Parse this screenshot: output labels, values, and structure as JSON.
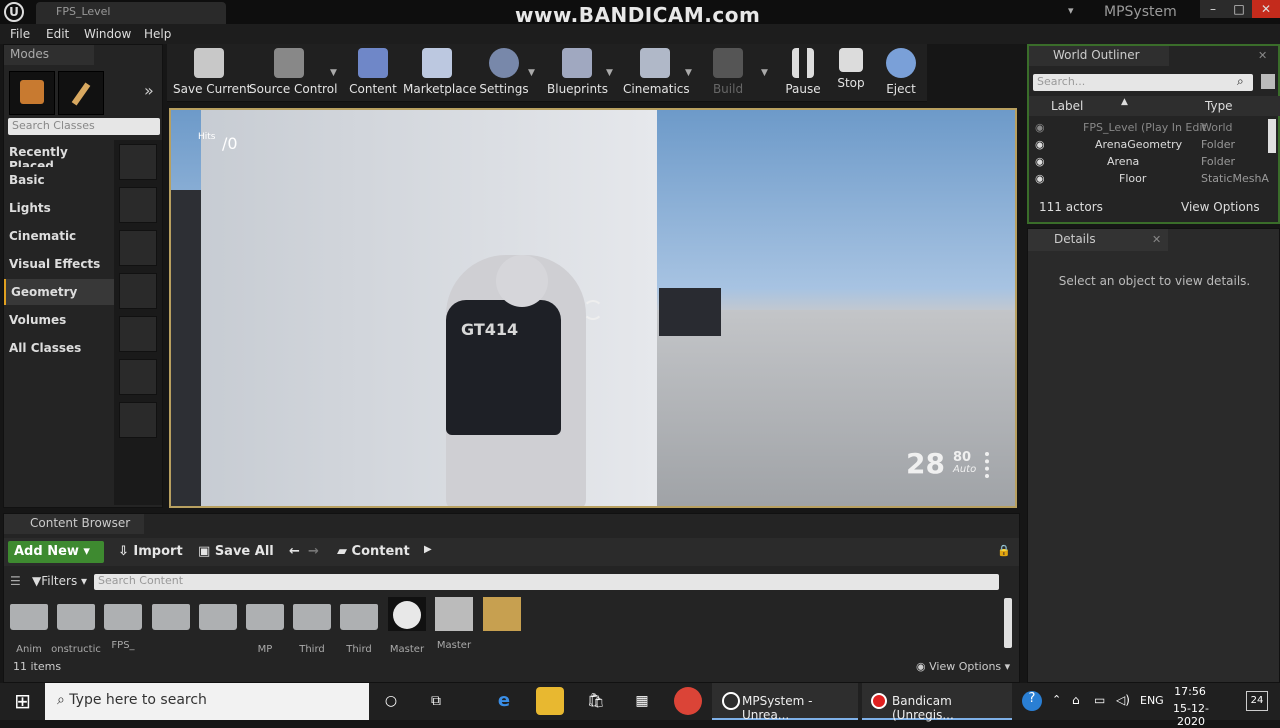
{
  "window": {
    "doc_tab": "FPS_Level",
    "project": "MPSystem",
    "watermark": "www.BANDICAM.com"
  },
  "menu": [
    "File",
    "Edit",
    "Window",
    "Help"
  ],
  "modes": {
    "tab": "Modes",
    "search_placeholder": "Search Classes",
    "categories": [
      "Recently Placed",
      "Basic",
      "Lights",
      "Cinematic",
      "Visual Effects",
      "Geometry",
      "Volumes",
      "All Classes"
    ],
    "active_category": "Geometry"
  },
  "toolbar": [
    "Save Current",
    "Source Control",
    "Content",
    "Marketplace",
    "Settings",
    "Blueprints",
    "Cinematics",
    "Build",
    "Pause",
    "Stop",
    "Eject"
  ],
  "viewport": {
    "hits_label": "Hits",
    "hits_value": "/0",
    "vest_text": "GT414",
    "ammo": "28",
    "ammo_reserve": "80",
    "fire_mode": "Auto"
  },
  "outliner": {
    "tab": "World Outliner",
    "search_placeholder": "Search...",
    "col_label": "Label",
    "col_type": "Type",
    "rows": [
      {
        "label": "FPS_Level (Play In Edit",
        "type": "World"
      },
      {
        "label": "ArenaGeometry",
        "type": "Folder"
      },
      {
        "label": "Arena",
        "type": "Folder"
      },
      {
        "label": "Floor",
        "type": "StaticMeshA"
      }
    ],
    "actor_count": "111 actors",
    "view_options": "View Options"
  },
  "details": {
    "tab": "Details",
    "message": "Select an object to view details."
  },
  "content_browser": {
    "tab": "Content Browser",
    "add_new": "Add New",
    "import": "Import",
    "save_all": "Save All",
    "path": "Content",
    "filters": "Filters",
    "search_placeholder": "Search Content",
    "assets": [
      "Anim",
      "onstructic",
      "FPS_",
      "",
      "",
      "MP",
      "Third",
      "Third",
      "Master",
      "Master",
      ""
    ],
    "item_count": "11 items",
    "view_options": "View Options"
  },
  "taskbar": {
    "search_placeholder": "Type here to search",
    "windows": [
      "MPSystem - Unrea...",
      "Bandicam (Unregis..."
    ],
    "lang": "ENG",
    "time": "17:56",
    "date": "15-12-2020",
    "notifications": "24"
  },
  "colors": {
    "accent_green": "#3e8a30",
    "viewport_border": "#b8a060",
    "outliner_border": "#3a6d2a"
  }
}
